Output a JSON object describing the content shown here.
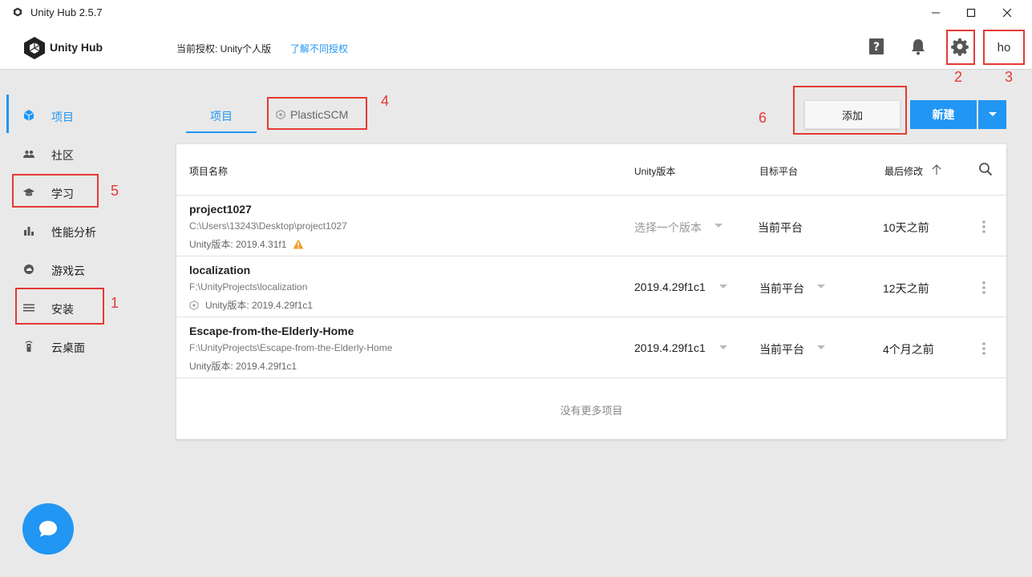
{
  "window": {
    "title": "Unity Hub 2.5.7"
  },
  "header": {
    "brand": "Unity Hub",
    "license_label": "当前授权: Unity个人版",
    "license_link": "了解不同授权",
    "account_initials": "ho"
  },
  "sidebar": {
    "items": [
      {
        "label": "项目",
        "icon": "cube-icon",
        "active": true
      },
      {
        "label": "社区",
        "icon": "people-icon"
      },
      {
        "label": "学习",
        "icon": "graduation-cap-icon"
      },
      {
        "label": "性能分析",
        "icon": "bar-chart-icon"
      },
      {
        "label": "游戏云",
        "icon": "cloud-icon"
      },
      {
        "label": "安装",
        "icon": "list-icon"
      },
      {
        "label": "云桌面",
        "icon": "remote-icon"
      }
    ]
  },
  "tabs": [
    {
      "label": "项目",
      "active": true
    },
    {
      "label": "PlasticSCM"
    }
  ],
  "actions": {
    "add": "添加",
    "new": "新建"
  },
  "table": {
    "headers": {
      "name": "项目名称",
      "version": "Unity版本",
      "platform": "目标平台",
      "modified": "最后修改"
    },
    "rows": [
      {
        "name": "project1027",
        "path": "C:\\Users\\13243\\Desktop\\project1027",
        "version_line": "Unity版本: 2019.4.31f1",
        "version_select": "选择一个版本",
        "platform": "当前平台",
        "modified": "10天之前",
        "warning": true
      },
      {
        "name": "localization",
        "path": "F:\\UnityProjects\\localization",
        "version_line": "Unity版本: 2019.4.29f1c1",
        "version_select": "2019.4.29f1c1",
        "platform": "当前平台",
        "modified": "12天之前"
      },
      {
        "name": "Escape-from-the-Elderly-Home",
        "path": "F:\\UnityProjects\\Escape-from-the-Elderly-Home",
        "version_line": "Unity版本: 2019.4.29f1c1",
        "version_select": "2019.4.29f1c1",
        "platform": "当前平台",
        "modified": "4个月之前"
      }
    ],
    "footer": "没有更多项目"
  },
  "annotations": [
    "1",
    "2",
    "3",
    "4",
    "5",
    "6"
  ],
  "colors": {
    "accent": "#2196f3",
    "annotation": "#e53935",
    "warning": "#f0a02c"
  }
}
